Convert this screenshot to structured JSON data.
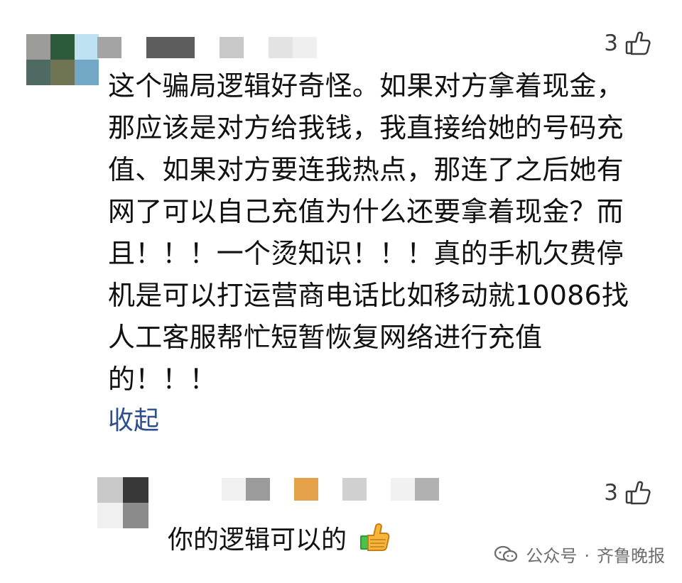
{
  "thread": {
    "comments": [
      {
        "like_count": "3",
        "lines": [
          "这个骗局逻辑好奇怪。如果对方拿着现金，",
          "那应该是对方给我钱，我直接给她的号码充",
          "值、如果对方要连我热点，那连了之后她有",
          "网了可以自己充值为什么还要拿着现金？而",
          "且！！！一个烫知识！！！真的手机欠费停",
          "机是可以打运营商电话比如移动就10086找",
          "人工客服帮忙短暂恢复网络进行充值",
          "的！！！"
        ],
        "collapse_label": "收起"
      },
      {
        "like_count": "3",
        "text": "你的逻辑可以的",
        "emoji": "thumbs-up-emoji"
      }
    ]
  },
  "watermark": {
    "separator": "·",
    "account_label": "公众号",
    "account_name": "齐鲁晚报"
  },
  "colors": {
    "link": "#2d4f8d",
    "text": "#111111",
    "muted": "#6d6d6d"
  },
  "icons": {
    "like": "thumbs-up-outline-icon",
    "watermark": "wechat-icon"
  }
}
